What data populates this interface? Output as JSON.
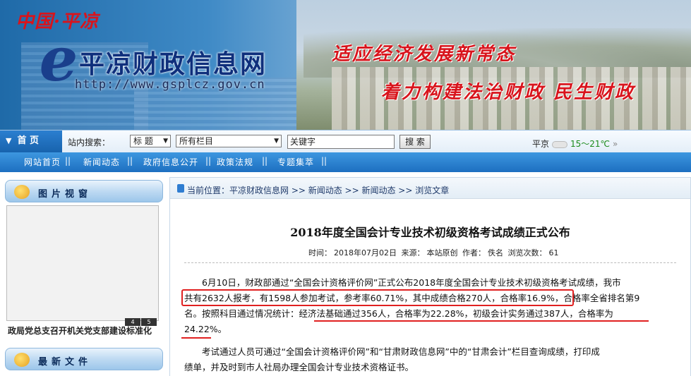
{
  "banner": {
    "region_label": "中国·平凉",
    "site_title": "平凉财政信息网",
    "site_url": "http://www.gsplcz.gov.cn",
    "slogan_1": "适应经济发展新常态",
    "slogan_2": "着力构建法治财政  民生财政"
  },
  "searchbar": {
    "home_label": "首 页",
    "search_label": "站内搜索：",
    "field_select": "标 题",
    "column_select": "所有栏目",
    "keyword_value": "关键字",
    "search_button": "搜 索",
    "weather_city": "平京",
    "weather_temp": "15～21℃",
    "weather_more": "»"
  },
  "nav": {
    "items": [
      "网站首页",
      "新闻动态",
      "政府信息公开",
      "政策法规",
      "专题集萃"
    ],
    "separator": "||"
  },
  "left": {
    "picture_panel_title": "图片视窗",
    "picture_nums": [
      "4",
      "5"
    ],
    "picture_caption": "政局党总支召开机关党支部建设标准化",
    "files_panel_title": "最新文件"
  },
  "article": {
    "breadcrumb": "当前位置：平凉财政信息网 >> 新闻动态 >> 新闻动态 >> 浏览文章",
    "title": "2018年度全国会计专业技术初级资格考试成绩正式公布",
    "meta_time_label": "时间：",
    "meta_time": "2018年07月02日",
    "meta_source_label": "来源：",
    "meta_source": "本站原创",
    "meta_author_label": "作者：",
    "meta_author": "佚名",
    "meta_views_label": "浏览次数：",
    "meta_views": "61",
    "p1_line1": "　　6月10日，财政部通过“全国会计资格评价网”正式公布2018年度全国会计专业技术初级资格考试成绩，我市",
    "p1_line2a": "共有2632人报考，有1598人参加考试，参考率60.71%，其中成绩合格270人，合格率16.9%",
    "p1_line2b": "，合格率全省排名第9",
    "p1_line3a": "名。按照科目通过情况统计：",
    "p1_line3b": "经济法基础通过356人，合格率为22.28%，初级会计实务通过387人，合格率为",
    "p1_line4": "24.22%。",
    "p2_line1": "　　考试通过人员可通过“全国会计资格评价网”和“甘肃财政信息网”中的“甘肃会计”栏目查询成绩，打印成",
    "p2_line2": "绩单，并及时到市人社局办理全国会计专业技术资格证书。"
  },
  "colors": {
    "nav_blue": "#1d6fc0",
    "highlight_red": "#e02020",
    "title_navy": "#0f2f7c",
    "slogan_red": "#d8141c"
  }
}
